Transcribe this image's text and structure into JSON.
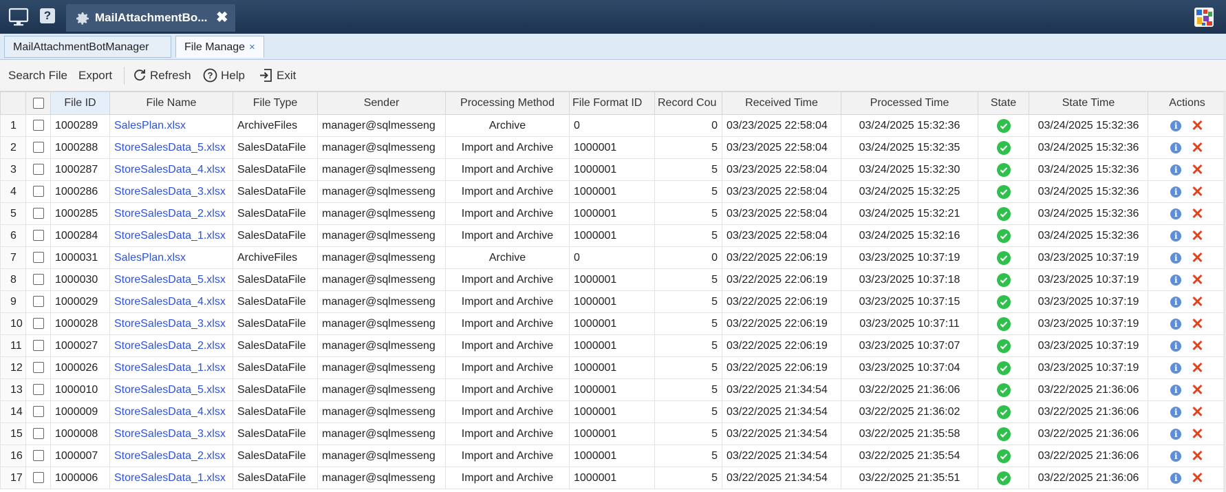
{
  "titlebar": {
    "app_tab_title": "MailAttachmentBo...",
    "icons": [
      "monitor-icon",
      "help-icon",
      "gear-icon",
      "close-icon",
      "app-logo-icon"
    ]
  },
  "doc_tabs": [
    {
      "label": "MailAttachmentBotManager"
    },
    {
      "label": "File Manage",
      "close": "×"
    }
  ],
  "toolbar": {
    "search_file": "Search File",
    "export": "Export",
    "refresh": "Refresh",
    "help": "Help",
    "exit": "Exit"
  },
  "columns": [
    "File ID",
    "File Name",
    "File Type",
    "Sender",
    "Processing Method",
    "File Format ID",
    "Record Cou",
    "Received Time",
    "Processed Time",
    "State",
    "State Time",
    "Actions"
  ],
  "rows": [
    [
      "1",
      "1000289",
      "SalesPlan.xlsx",
      "ArchiveFiles",
      "manager@sqlmesseng",
      "Archive",
      "0",
      "0",
      "03/23/2025 22:58:04",
      "03/24/2025 15:32:36",
      "03/24/2025 15:32:36"
    ],
    [
      "2",
      "1000288",
      "StoreSalesData_5.xlsx",
      "SalesDataFile",
      "manager@sqlmesseng",
      "Import and Archive",
      "1000001",
      "5",
      "03/23/2025 22:58:04",
      "03/24/2025 15:32:35",
      "03/24/2025 15:32:36"
    ],
    [
      "3",
      "1000287",
      "StoreSalesData_4.xlsx",
      "SalesDataFile",
      "manager@sqlmesseng",
      "Import and Archive",
      "1000001",
      "5",
      "03/23/2025 22:58:04",
      "03/24/2025 15:32:30",
      "03/24/2025 15:32:36"
    ],
    [
      "4",
      "1000286",
      "StoreSalesData_3.xlsx",
      "SalesDataFile",
      "manager@sqlmesseng",
      "Import and Archive",
      "1000001",
      "5",
      "03/23/2025 22:58:04",
      "03/24/2025 15:32:25",
      "03/24/2025 15:32:36"
    ],
    [
      "5",
      "1000285",
      "StoreSalesData_2.xlsx",
      "SalesDataFile",
      "manager@sqlmesseng",
      "Import and Archive",
      "1000001",
      "5",
      "03/23/2025 22:58:04",
      "03/24/2025 15:32:21",
      "03/24/2025 15:32:36"
    ],
    [
      "6",
      "1000284",
      "StoreSalesData_1.xlsx",
      "SalesDataFile",
      "manager@sqlmesseng",
      "Import and Archive",
      "1000001",
      "5",
      "03/23/2025 22:58:04",
      "03/24/2025 15:32:16",
      "03/24/2025 15:32:36"
    ],
    [
      "7",
      "1000031",
      "SalesPlan.xlsx",
      "ArchiveFiles",
      "manager@sqlmesseng",
      "Archive",
      "0",
      "0",
      "03/22/2025 22:06:19",
      "03/23/2025 10:37:19",
      "03/23/2025 10:37:19"
    ],
    [
      "8",
      "1000030",
      "StoreSalesData_5.xlsx",
      "SalesDataFile",
      "manager@sqlmesseng",
      "Import and Archive",
      "1000001",
      "5",
      "03/22/2025 22:06:19",
      "03/23/2025 10:37:18",
      "03/23/2025 10:37:19"
    ],
    [
      "9",
      "1000029",
      "StoreSalesData_4.xlsx",
      "SalesDataFile",
      "manager@sqlmesseng",
      "Import and Archive",
      "1000001",
      "5",
      "03/22/2025 22:06:19",
      "03/23/2025 10:37:15",
      "03/23/2025 10:37:19"
    ],
    [
      "10",
      "1000028",
      "StoreSalesData_3.xlsx",
      "SalesDataFile",
      "manager@sqlmesseng",
      "Import and Archive",
      "1000001",
      "5",
      "03/22/2025 22:06:19",
      "03/23/2025 10:37:11",
      "03/23/2025 10:37:19"
    ],
    [
      "11",
      "1000027",
      "StoreSalesData_2.xlsx",
      "SalesDataFile",
      "manager@sqlmesseng",
      "Import and Archive",
      "1000001",
      "5",
      "03/22/2025 22:06:19",
      "03/23/2025 10:37:07",
      "03/23/2025 10:37:19"
    ],
    [
      "12",
      "1000026",
      "StoreSalesData_1.xlsx",
      "SalesDataFile",
      "manager@sqlmesseng",
      "Import and Archive",
      "1000001",
      "5",
      "03/22/2025 22:06:19",
      "03/23/2025 10:37:04",
      "03/23/2025 10:37:19"
    ],
    [
      "13",
      "1000010",
      "StoreSalesData_5.xlsx",
      "SalesDataFile",
      "manager@sqlmesseng",
      "Import and Archive",
      "1000001",
      "5",
      "03/22/2025 21:34:54",
      "03/22/2025 21:36:06",
      "03/22/2025 21:36:06"
    ],
    [
      "14",
      "1000009",
      "StoreSalesData_4.xlsx",
      "SalesDataFile",
      "manager@sqlmesseng",
      "Import and Archive",
      "1000001",
      "5",
      "03/22/2025 21:34:54",
      "03/22/2025 21:36:02",
      "03/22/2025 21:36:06"
    ],
    [
      "15",
      "1000008",
      "StoreSalesData_3.xlsx",
      "SalesDataFile",
      "manager@sqlmesseng",
      "Import and Archive",
      "1000001",
      "5",
      "03/22/2025 21:34:54",
      "03/22/2025 21:35:58",
      "03/22/2025 21:36:06"
    ],
    [
      "16",
      "1000007",
      "StoreSalesData_2.xlsx",
      "SalesDataFile",
      "manager@sqlmesseng",
      "Import and Archive",
      "1000001",
      "5",
      "03/22/2025 21:34:54",
      "03/22/2025 21:35:54",
      "03/22/2025 21:36:06"
    ],
    [
      "17",
      "1000006",
      "StoreSalesData_1.xlsx",
      "SalesDataFile",
      "manager@sqlmesseng",
      "Import and Archive",
      "1000001",
      "5",
      "03/22/2025 21:34:54",
      "03/22/2025 21:35:51",
      "03/22/2025 21:36:06"
    ]
  ],
  "state_icon": "success-check-icon",
  "action_icons": [
    "info-icon",
    "delete-icon"
  ],
  "colors": {
    "titlebar": "#1d3350",
    "link": "#2f52d8",
    "state_ok": "#2fbf4b",
    "delete": "#e2421f",
    "info": "#5b8fd6"
  }
}
